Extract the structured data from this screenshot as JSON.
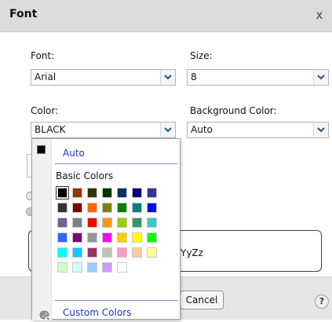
{
  "dialog": {
    "title": "Font",
    "close_label": "x"
  },
  "font": {
    "label": "Font:",
    "value": "Arial"
  },
  "size": {
    "label": "Size:",
    "value": "8"
  },
  "color": {
    "label": "Color:",
    "value": "BLACK"
  },
  "background_color": {
    "label": "Background Color:",
    "value": "Auto"
  },
  "preview": {
    "text": "YyZz"
  },
  "footer": {
    "cancel_label": "Cancel",
    "help_label": "?"
  },
  "color_popup": {
    "auto_label": "Auto",
    "auto_color": "#000000",
    "basic_colors_label": "Basic Colors",
    "custom_colors_label": "Custom Colors",
    "basic_colors": [
      [
        "#000000",
        "#993300",
        "#333300",
        "#003300",
        "#003366",
        "#000080",
        "#333399"
      ],
      [
        "#333333",
        "#800000",
        "#FF6600",
        "#808000",
        "#008000",
        "#008080",
        "#0000FF"
      ],
      [
        "#666699",
        "#808080",
        "#FF0000",
        "#FF9900",
        "#99CC00",
        "#339966",
        "#33CCCC"
      ],
      [
        "#3366FF",
        "#800080",
        "#969696",
        "#FF00FF",
        "#FFCC00",
        "#FFFF00",
        "#00FF00"
      ],
      [
        "#00FFFF",
        "#00CCFF",
        "#993366",
        "#C0C0C0",
        "#FF99CC",
        "#FFCC99",
        "#FFFF99"
      ],
      [
        "#CCFFCC",
        "#CCFFFF",
        "#99CCFF",
        "#CC99FF",
        "#FFFFFF"
      ]
    ],
    "selected_color": "#000000"
  }
}
